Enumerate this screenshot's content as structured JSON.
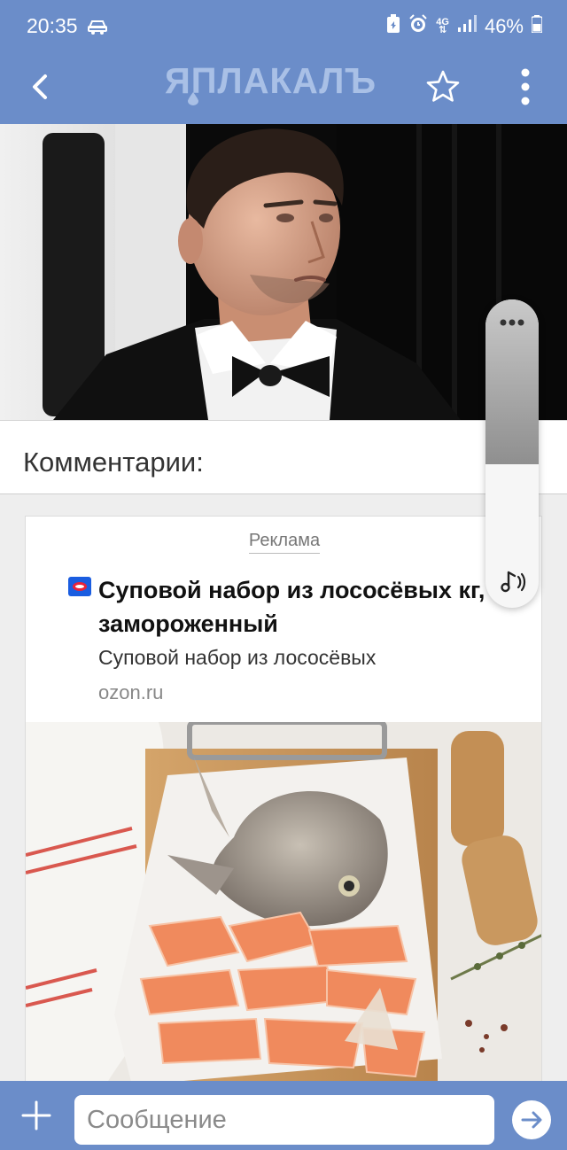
{
  "status_bar": {
    "time": "20:35",
    "network_label": "4G",
    "battery": "46%"
  },
  "header": {
    "logo_text": "ЯПЛАКАЛЪ",
    "back_icon": "chevron-left-icon",
    "favorite_icon": "star-outline-icon",
    "menu_icon": "kebab-menu-icon"
  },
  "comments": {
    "title": "Комментарии:"
  },
  "ad": {
    "label": "Реклама",
    "title": "Суповой набор из лососёвых кг, замороженный",
    "description": "Суповой набор из лососёвых",
    "domain": "ozon.ru"
  },
  "volume_panel": {
    "level": 0.54,
    "more_icon": "more-dots-icon",
    "media_icon": "music-note-icon"
  },
  "message_bar": {
    "placeholder": "Сообщение",
    "add_icon": "plus-icon",
    "send_icon": "arrow-right-icon"
  },
  "colors": {
    "header_bg": "#6b8dc9",
    "logo": "#a9c0e6",
    "send_arrow": "#6b8dc9",
    "ad_logo_blue": "#1a5de0",
    "ad_logo_red": "#e8233a"
  }
}
